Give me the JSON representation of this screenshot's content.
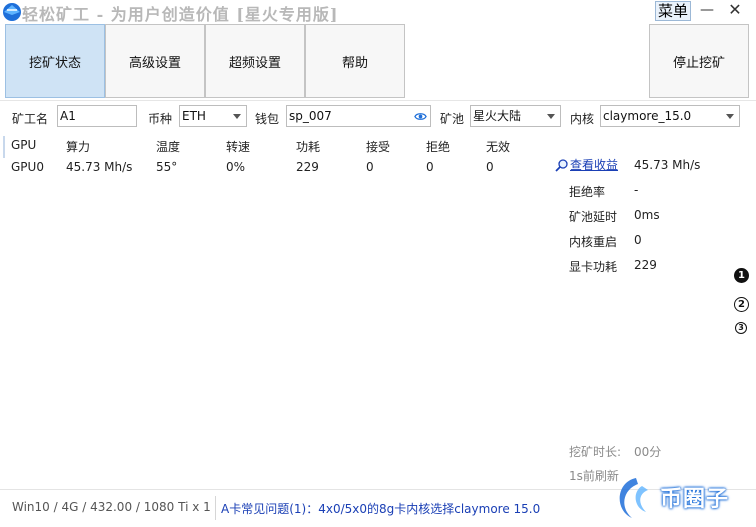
{
  "title": "轻松矿工 - 为用户创造价值 [星火专用版]",
  "window": {
    "menu_label": "菜单",
    "minimize_glyph": "—",
    "close_glyph": "✕"
  },
  "nav": [
    {
      "label": "挖矿状态",
      "active": true
    },
    {
      "label": "高级设置",
      "active": false
    },
    {
      "label": "超频设置",
      "active": false
    },
    {
      "label": "帮助",
      "active": false
    }
  ],
  "stop_button": "停止挖矿",
  "config": {
    "worker_label": "矿工名",
    "worker_value": "A1",
    "coin_label": "币种",
    "coin_value": "ETH",
    "wallet_label": "钱包",
    "wallet_value": "sp_007",
    "pool_label": "矿池",
    "pool_value": "星火大陆",
    "kernel_label": "内核",
    "kernel_value": "claymore_15.0"
  },
  "table": {
    "headers": [
      "GPU",
      "算力",
      "温度",
      "转速",
      "功耗",
      "接受",
      "拒绝",
      "无效"
    ],
    "rows": [
      [
        "GPU0",
        "45.73 Mh/s",
        "55°",
        "0%",
        "229",
        "0",
        "0",
        "0"
      ]
    ]
  },
  "stats": {
    "earnings_link": "查看收益",
    "earnings_value": "45.73 Mh/s",
    "items": [
      {
        "label": "拒绝率",
        "value": "-"
      },
      {
        "label": "矿池延时",
        "value": "0ms"
      },
      {
        "label": "内核重启",
        "value": "0"
      },
      {
        "label": "显卡功耗",
        "value": "229"
      }
    ],
    "mining_time_label": "挖矿时长:",
    "mining_time_value": "00分",
    "refresh_text": "1s前刷新"
  },
  "pages": [
    "1",
    "2",
    "3"
  ],
  "status": {
    "system_info": "Win10 / 4G / 432.00 / 1080 Ti x 1",
    "news": "A卡常见问题(1)：4x0/5x0的8g卡内核选择claymore 15.0"
  },
  "watermark": "币圈子",
  "colors": {
    "accent": "#1a3fb5",
    "active_tab": "#cfe3f5",
    "title_gray": "#b8b8b8"
  }
}
